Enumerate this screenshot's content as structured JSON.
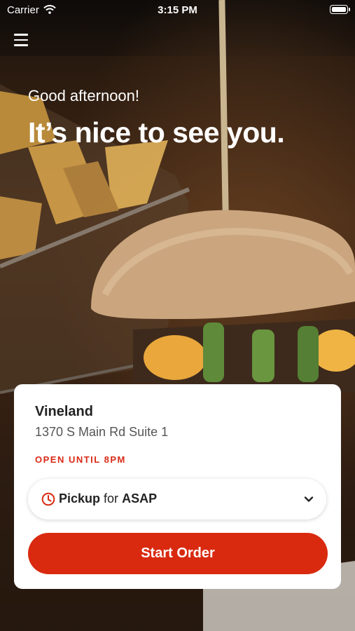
{
  "status_bar": {
    "carrier": "Carrier",
    "time": "3:15 PM"
  },
  "header": {
    "menu_icon": "hamburger-menu-icon"
  },
  "hero": {
    "greeting": "Good afternoon!",
    "headline": "It’s nice to see you."
  },
  "location_card": {
    "name": "Vineland",
    "address": "1370 S Main Rd Suite 1",
    "status": "OPEN UNTIL 8PM",
    "order_mode": {
      "icon": "clock-icon",
      "mode": "Pickup",
      "connector": "for",
      "time": "ASAP"
    },
    "start_button_label": "Start Order"
  },
  "colors": {
    "accent": "#d92a10",
    "status_text": "#d92a17"
  }
}
